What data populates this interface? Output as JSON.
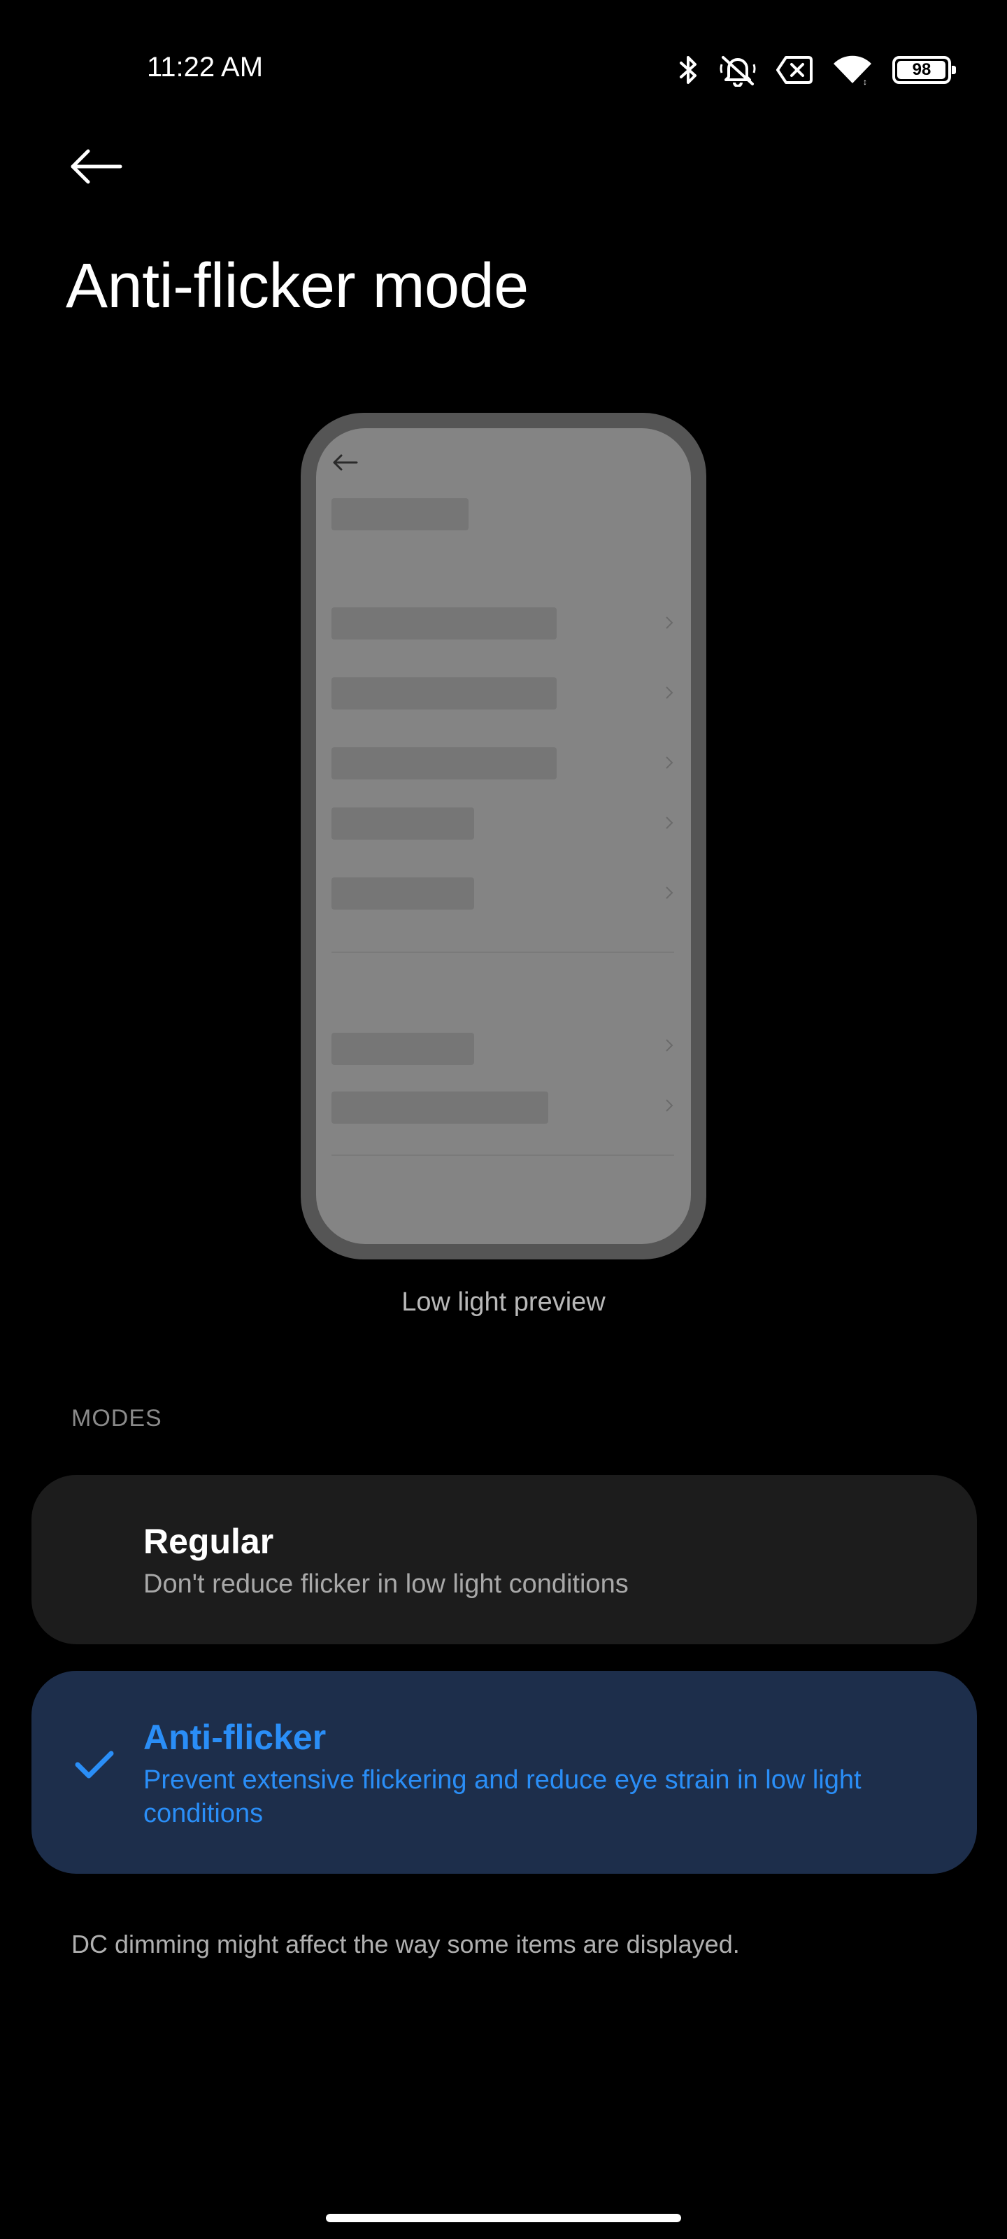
{
  "status_bar": {
    "time": "11:22 AM",
    "battery_level": "98",
    "battery_fraction": 0.98,
    "icons": [
      "bluetooth-icon",
      "mute-icon",
      "no-sim-icon",
      "wifi-icon",
      "battery-icon"
    ]
  },
  "header": {
    "back_icon": "arrow-left-icon",
    "title": "Anti-flicker mode"
  },
  "preview": {
    "caption": "Low light preview"
  },
  "modes": {
    "section_label": "MODES",
    "items": [
      {
        "title": "Regular",
        "description": "Don't reduce flicker in low light conditions",
        "selected": false
      },
      {
        "title": "Anti-flicker",
        "description": "Prevent extensive flickering and reduce eye strain in low light conditions",
        "selected": true
      }
    ]
  },
  "footnote": "DC dimming might affect the way some items are displayed.",
  "colors": {
    "background": "#000000",
    "accent": "#2a8ef7",
    "selected_card": "#1d2e4b",
    "card": "#1c1c1c"
  }
}
